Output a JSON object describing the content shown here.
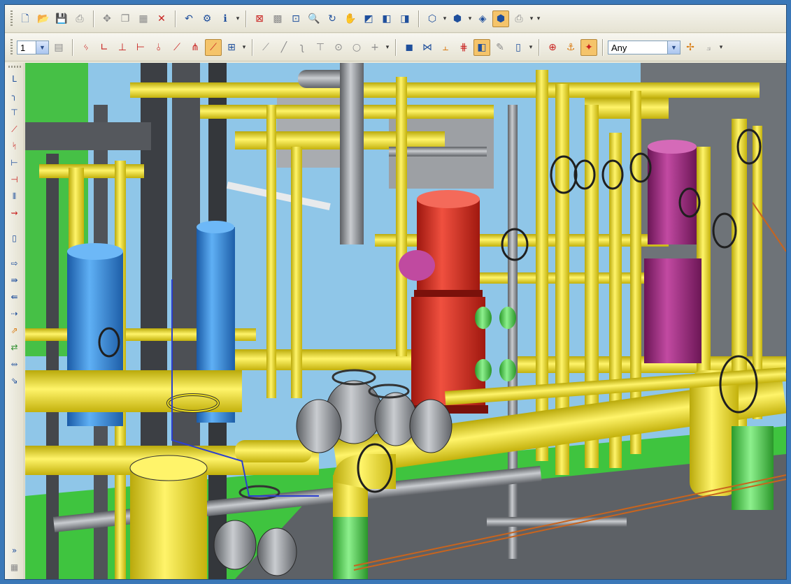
{
  "toolbar": {
    "layer_value": "1",
    "filter_value": "Any",
    "row1_icons": [
      "new-document-icon",
      "open-folder-icon",
      "save-icon",
      "print-icon",
      "move-icon",
      "copy-icon",
      "paste-icon",
      "delete-icon",
      "undo-icon",
      "properties-icon",
      "info-icon",
      "zoom-extents-icon",
      "zoom-window-icon",
      "zoom-box-icon",
      "zoom-icon",
      "rotate-icon",
      "pan-icon",
      "render-icon",
      "view-previous-icon",
      "view-next-icon",
      "wireframe-cube-icon",
      "shaded-cube-icon",
      "hidden-line-cube-icon",
      "solid-cube-icon",
      "printer-view-icon"
    ],
    "row2_icons": [
      "layer-manager-icon",
      "pipe-route-icon",
      "elbow-icon",
      "tee-icon",
      "branch-icon",
      "reducer-icon",
      "slope-icon",
      "connect-icon",
      "active-route-icon",
      "insert-component-icon",
      "line-icon",
      "diagonal-line-icon",
      "curve-icon",
      "cross-icon",
      "circle-icon",
      "ring-icon",
      "plus-icon",
      "equipment-icon",
      "valve-icon",
      "support-icon",
      "flange-icon",
      "active-model-icon",
      "annotate-icon",
      "door-icon",
      "snap-center-icon",
      "snap-node-icon",
      "snap-active-icon",
      "filter-pick-icon",
      "filter-extra-icon"
    ]
  },
  "side_toolbar": {
    "icons": [
      "route-pipe-icon",
      "route-bend-icon",
      "route-tee-icon",
      "route-slope-icon",
      "route-branch-icon",
      "route-reducer-icon",
      "route-flange-icon",
      "route-gap-icon",
      "route-cut-icon",
      "route-insert-icon",
      "route-align-icon",
      "route-move-icon",
      "route-rotate-icon",
      "route-stretch-icon",
      "route-copy-icon",
      "route-mirror-icon",
      "route-join-icon",
      "route-check-icon",
      "more-tools-icon",
      "grid-icon"
    ]
  },
  "viewport": {
    "scene": "3D plant piping model",
    "colors": {
      "pipe": "#f2e21a",
      "steel": "#8a8d92",
      "vessel_blue": "#2f86d6",
      "vessel_red": "#d92a1f",
      "vessel_purple": "#9c2a7e",
      "floor": "#4bd04b",
      "sky": "#8fc6e8"
    }
  }
}
